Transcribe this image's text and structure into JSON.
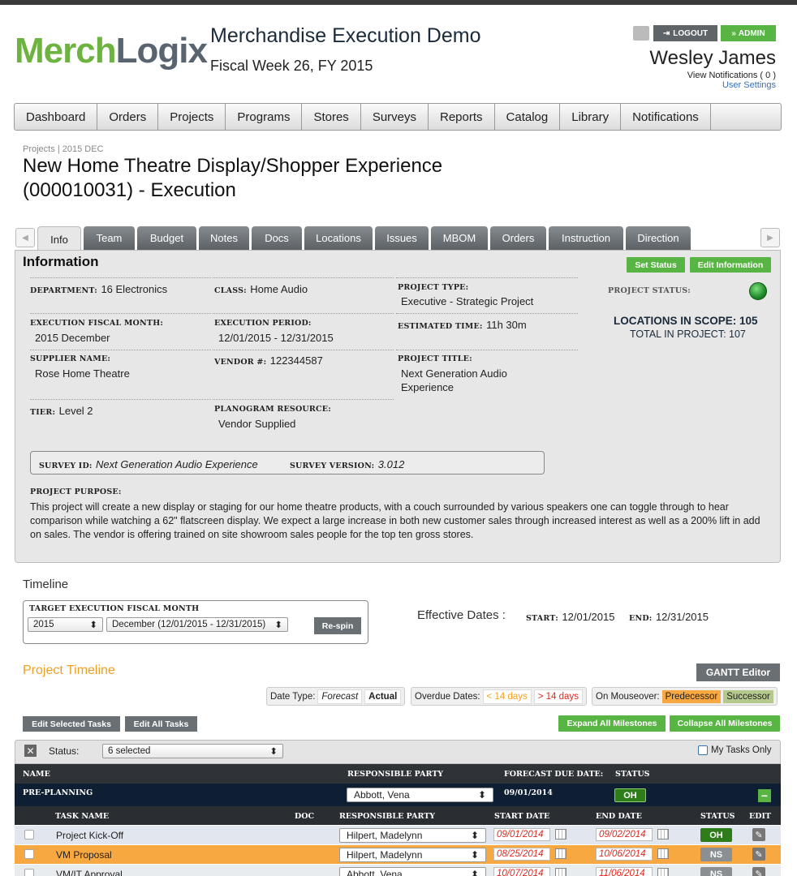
{
  "header": {
    "logo_part1": "Merch",
    "logo_part2": "Logix",
    "app_title": "Merchandise Execution Demo",
    "fiscal_week": "Fiscal Week 26, FY 2015",
    "logout_label": "LOGOUT",
    "admin_label": "ADMIN",
    "user_name": "Wesley James",
    "notifications_link": "View Notifications ( 0 )",
    "user_settings_link": "User Settings"
  },
  "nav": {
    "items": [
      "Dashboard",
      "Orders",
      "Projects",
      "Programs",
      "Stores",
      "Surveys",
      "Reports",
      "Catalog",
      "Library",
      "Notifications"
    ]
  },
  "breadcrumb": {
    "root": "Projects",
    "sep": "|",
    "period": "2015 DEC"
  },
  "page": {
    "title_line1": "New Home Theatre Display/Shopper Experience",
    "title_line2": "(000010031) - Execution"
  },
  "tabs": [
    "Info",
    "Team",
    "Budget",
    "Notes",
    "Docs",
    "Locations",
    "Issues",
    "MBOM",
    "Orders",
    "Instruction",
    "Direction"
  ],
  "info": {
    "heading": "Information",
    "set_status_label": "Set Status",
    "edit_info_label": "Edit Information",
    "department_label": "DEPARTMENT:",
    "department": "16 Electronics",
    "class_label": "CLASS:",
    "class": "Home Audio",
    "project_type_label": "PROJECT TYPE:",
    "project_type": "Executive - Strategic Project",
    "exec_month_label": "EXECUTION FISCAL MONTH:",
    "exec_month": "2015 December",
    "exec_period_label": "EXECUTION PERIOD:",
    "exec_period": "12/01/2015 - 12/31/2015",
    "est_time_label": "ESTIMATED TIME:",
    "est_time": "11h 30m",
    "supplier_label": "SUPPLIER NAME:",
    "supplier": "Rose Home Theatre",
    "vendor_label": "VENDOR #:",
    "vendor": "122344587",
    "project_title_label": "PROJECT TITLE:",
    "project_title_l1": "Next Generation Audio",
    "project_title_l2": "Experience",
    "tier_label": "TIER:",
    "tier": "Level 2",
    "planogram_label": "PLANOGRAM RESOURCE:",
    "planogram": "Vendor Supplied",
    "project_status_label": "PROJECT STATUS:",
    "project_status_color": "#1f8a2a",
    "locations_label": "LOCATIONS IN SCOPE:",
    "locations_count": "105",
    "total_label": "TOTAL IN PROJECT:",
    "total_count": "107",
    "survey_id_label": "SURVEY ID:",
    "survey_id": "Next Generation Audio Experience",
    "survey_version_label": "SURVEY VERSION:",
    "survey_version": "3.012",
    "purpose_label": "PROJECT PURPOSE:",
    "purpose": "This project will create a new display or staging for our home theatre products, with a couch surrounded by various speakers one can toggle through to hear comparison while watching a 62\" flatscreen display. We expect a large increase in both new customer sales through increased interest as well as a 200% lift in add on sales. The vendor is offering trained on site showroom sales people for the top ten gross stores."
  },
  "timeline": {
    "heading": "Timeline",
    "target_label": "TARGET EXECUTION FISCAL MONTH",
    "year": "2015",
    "month": "December (12/01/2015 - 12/31/2015)",
    "respin_label": "Re-spin",
    "effective_label": "Effective Dates :",
    "start_label": "START:",
    "start": "12/01/2015",
    "end_label": "END:",
    "end": "12/31/2015"
  },
  "project_timeline": {
    "heading": "Project Timeline",
    "gantt_label": "GANTT Editor",
    "date_type_label": "Date Type:",
    "forecast_label": "Forecast",
    "actual_label": "Actual",
    "overdue_label": "Overdue Dates:",
    "lt14": "< 14 days",
    "gt14": "> 14 days",
    "mouseover_label": "On Mouseover:",
    "predecessor_label": "Predecessor",
    "successor_label": "Successor",
    "edit_selected_label": "Edit Selected Tasks",
    "edit_all_label": "Edit All Tasks",
    "expand_label": "Expand All Milestones",
    "collapse_label": "Collapse All Milestones",
    "status_filter_label": "Status:",
    "status_filter_value": "6 selected",
    "my_tasks_label": "My Tasks Only"
  },
  "table": {
    "h_name": "NAME",
    "h_resp": "RESPONSIBLE PARTY",
    "h_forecast": "FORECAST DUE DATE:",
    "h_status": "STATUS",
    "milestone": {
      "name": "PRE-PLANNING",
      "resp": "Abbott, Vena",
      "due": "09/01/2014",
      "status": "OH"
    },
    "h_task": "TASK NAME",
    "h_doc": "DOC",
    "h_resp2": "RESPONSIBLE PARTY",
    "h_start": "START DATE",
    "h_end": "END DATE",
    "h_status2": "STATUS",
    "h_edit": "EDIT",
    "rows": [
      {
        "task": "Project Kick-Off",
        "resp": "Hilpert, Madelynn",
        "start": "09/01/2014",
        "end": "09/02/2014",
        "status": "OH"
      },
      {
        "task": "VM Proposal",
        "resp": "Hilpert, Madelynn",
        "start": "08/25/2014",
        "end": "10/06/2014",
        "status": "NS"
      },
      {
        "task": "VM/IT Approval",
        "resp": "Abbott, Vena",
        "start": "10/07/2014",
        "end": "11/06/2014",
        "status": "NS"
      }
    ]
  }
}
